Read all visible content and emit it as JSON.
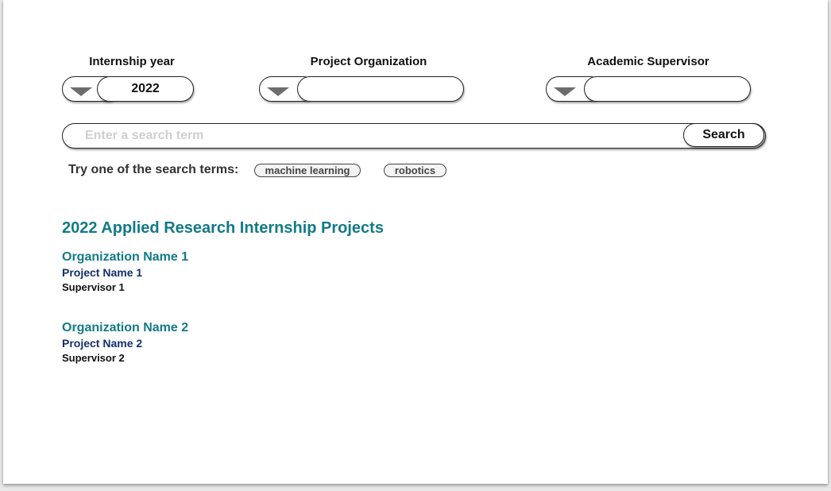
{
  "filters": {
    "year": {
      "label": "Internship year",
      "value": "2022"
    },
    "organization": {
      "label": "Project Organization",
      "value": ""
    },
    "supervisor": {
      "label": "Academic Supervisor",
      "value": ""
    }
  },
  "search": {
    "placeholder": "Enter a search term",
    "value": "",
    "button_label": "Search"
  },
  "suggestions": {
    "prompt": "Try one of the search terms:",
    "terms": [
      "machine learning",
      "robotics"
    ]
  },
  "results": {
    "title": "2022 Applied Research Internship Projects",
    "items": [
      {
        "organization": "Organization Name 1",
        "project": "Project Name 1",
        "supervisor": "Supervisor 1"
      },
      {
        "organization": "Organization Name 2",
        "project": "Project Name 2",
        "supervisor": "Supervisor 2"
      }
    ]
  },
  "colors": {
    "accent_teal": "#127a87",
    "project_navy": "#132f6b",
    "placeholder_gray": "#cfcfcf"
  }
}
